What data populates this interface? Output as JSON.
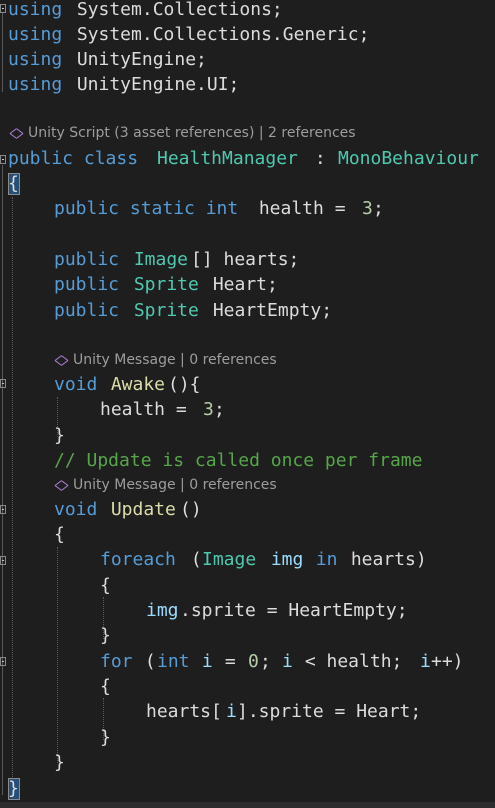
{
  "codelens": [
    {
      "text": "Unity Script (3 asset references) | 2 references"
    },
    {
      "text": "Unity Message | 0 references"
    },
    {
      "text": "Unity Message | 0 references"
    }
  ],
  "code": {
    "l1": {
      "kw": "using",
      "rest": " System.Collections;"
    },
    "l2": {
      "kw": "using",
      "rest": " System.Collections.Generic;"
    },
    "l3": {
      "kw": "using",
      "rest": " UnityEngine;"
    },
    "l4": {
      "kw": "using",
      "rest": " UnityEngine.UI;"
    },
    "l5": {
      "kw": "public class ",
      "name": "HealthManager",
      "sep": " : ",
      "base": "MonoBehaviour"
    },
    "l6": {
      "brace": "{"
    },
    "l7": {
      "kw": "public static int",
      "rest": " health = ",
      "num": "3",
      "end": ";"
    },
    "l8": {
      "kw": "public",
      "type": " Image",
      "rest": "[] hearts;"
    },
    "l9": {
      "kw": "public",
      "type": " Sprite",
      "rest": " Heart;"
    },
    "l10": {
      "kw": "public",
      "type": " Sprite",
      "rest": " HeartEmpty;"
    },
    "l11": {
      "kw": "void",
      "method": " Awake",
      "rest": "(){"
    },
    "l12": {
      "rest": "health = ",
      "num": "3",
      "end": ";"
    },
    "l13": {
      "rest": "}"
    },
    "l14": {
      "comment": "// Update is called once per frame"
    },
    "l15": {
      "kw": "void",
      "method": " Update",
      "rest": "()"
    },
    "l16": {
      "rest": "{"
    },
    "l17": {
      "kw": "foreach",
      "p1": " (",
      "type": "Image",
      "var": " img",
      "kw2": " in",
      "rest": " hearts)"
    },
    "l18": {
      "rest": "{"
    },
    "l19": {
      "var": "img",
      "rest": ".sprite = HeartEmpty;"
    },
    "l20": {
      "rest": "}"
    },
    "l21": {
      "kw": "for",
      "p1": " (",
      "kw2": "int",
      "var": " i",
      "p2": " = ",
      "num": "0",
      "p3": "; ",
      "var2": "i",
      "p4": " < health; ",
      "var3": "i",
      "p5": "++)"
    },
    "l22": {
      "rest": "{"
    },
    "l23": {
      "rest": "hearts[",
      "var": "i",
      "end": "].sprite = Heart;"
    },
    "l24": {
      "rest": "}"
    },
    "l25": {
      "rest": "}"
    },
    "l26": {
      "brace": "}"
    }
  }
}
